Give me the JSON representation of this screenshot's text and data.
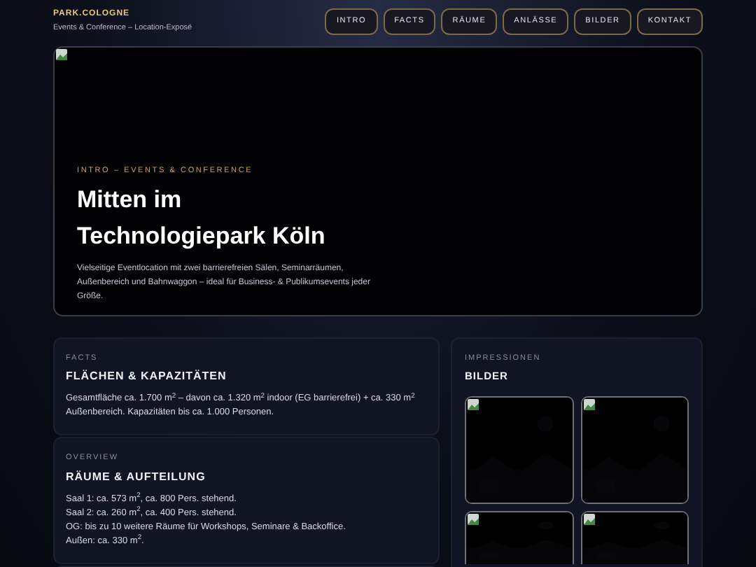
{
  "brand": {
    "name": "PARK.COLOGNE",
    "tagline": "Events & Conference – Location-Exposé"
  },
  "nav": [
    {
      "label": "INTRO"
    },
    {
      "label": "FACTS"
    },
    {
      "label": "RÄUME"
    },
    {
      "label": "ANLÄSSE"
    },
    {
      "label": "BILDER"
    },
    {
      "label": "KONTAKT"
    }
  ],
  "hero": {
    "eyebrow": "INTRO – EVENTS & CONFERENCE",
    "title_lines": [
      "Mitten im",
      "Technologiepark Köln"
    ],
    "text": "Vielseitige Eventlocation mit zwei barrierefreien Sälen, Seminarräumen, Außenbereich und Bahnwaggon – ideal für Business- & Publikumsevents jeder Größe."
  },
  "cards": [
    {
      "eyebrow": "FACTS",
      "title": "FLÄCHEN & KAPAZITÄTEN",
      "lines": [
        "Gesamtfläche ca. 1.700 m$^{2}$ – davon ca. 1.320 m$^{2}$ indoor (EG barrierefrei) + ca. 330 m$^{2}$ Außenbereich. Kapazitäten bis ca. 1.000 Personen."
      ]
    },
    {
      "eyebrow": "OVERVIEW",
      "title": "RÄUME & AUFTEILUNG",
      "lines": [
        "Saal 1: ca. 573 m$^{2}$, ca. 800 Pers. stehend.",
        "Saal 2: ca. 260 m$^{2}$, ca. 400 Pers. stehend.",
        "OG: bis zu 10 weitere Räume für Workshops, Seminare & Backoffice.",
        "Außen: ca. 330 m$^{2}$."
      ]
    }
  ],
  "gallery": {
    "eyebrow": "IMPRESSIONEN",
    "title": "BILDER"
  }
}
